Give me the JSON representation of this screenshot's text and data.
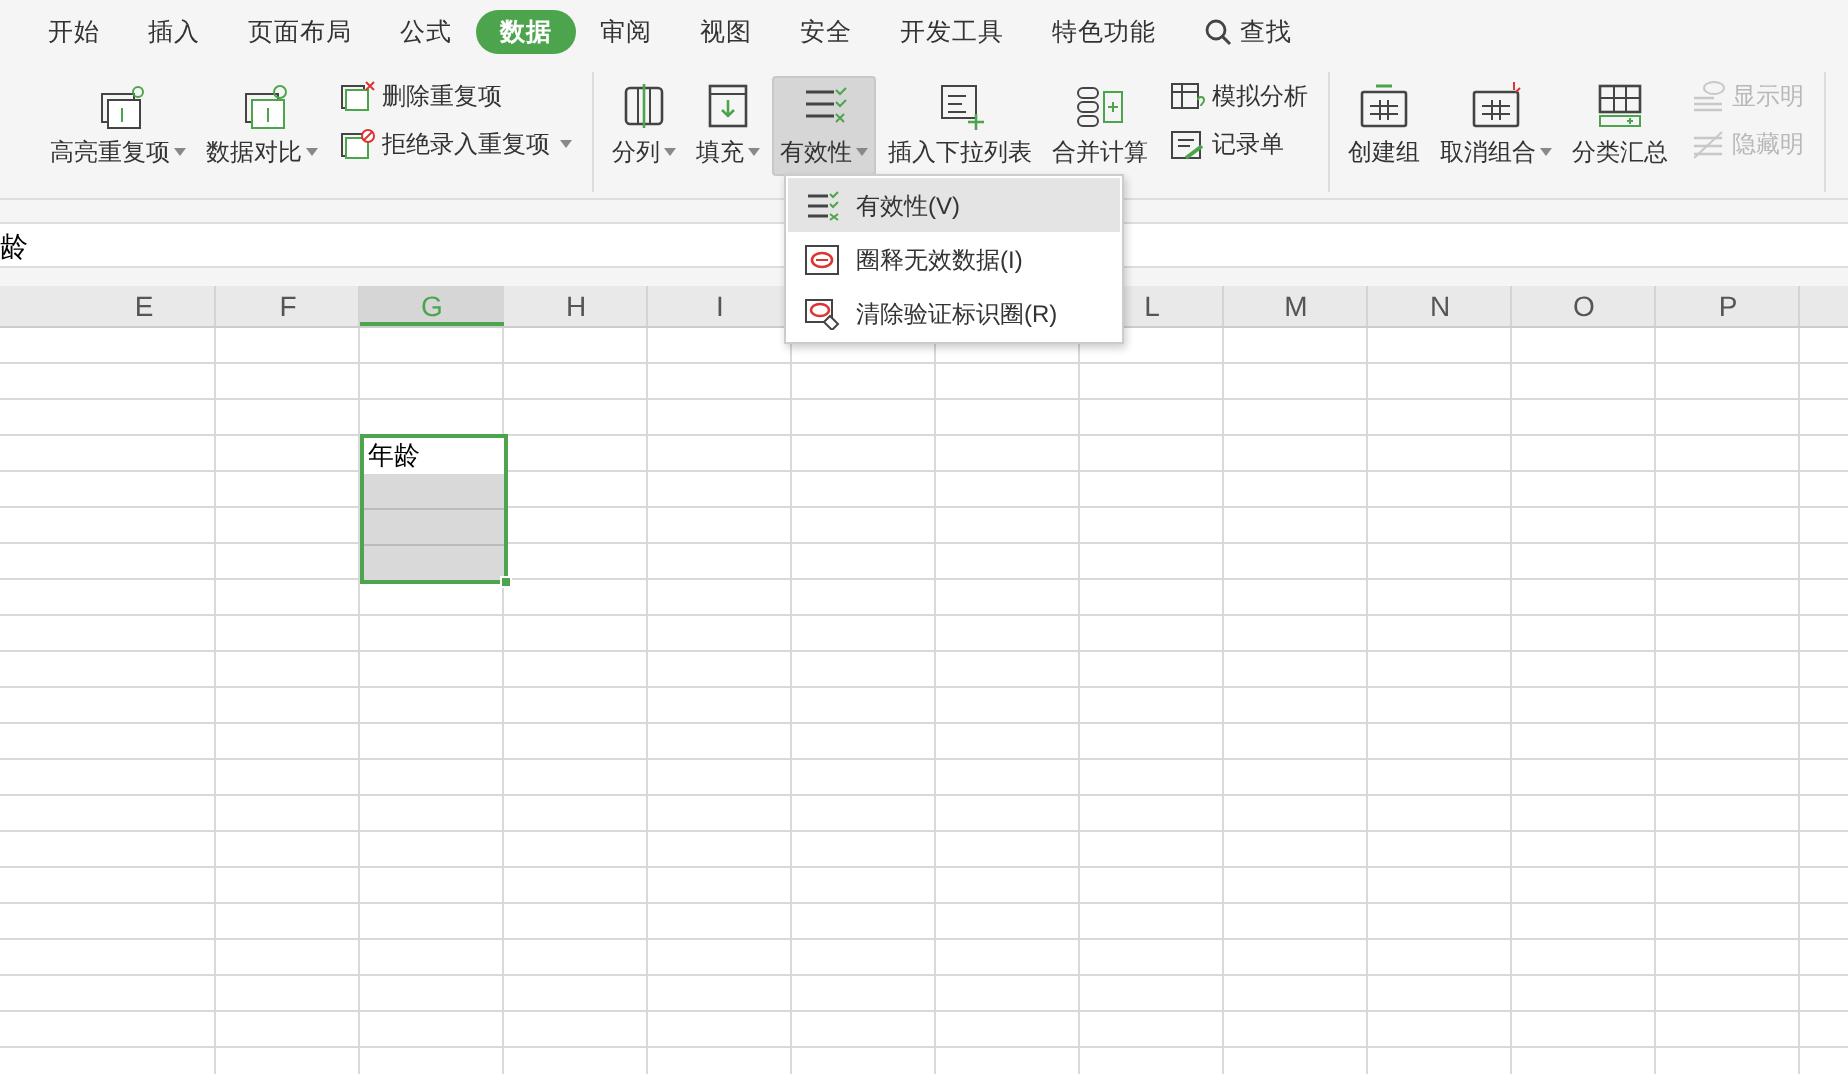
{
  "tabs": [
    {
      "label": "开始",
      "selected": false
    },
    {
      "label": "插入",
      "selected": false
    },
    {
      "label": "页面布局",
      "selected": false
    },
    {
      "label": "公式",
      "selected": false
    },
    {
      "label": "数据",
      "selected": true
    },
    {
      "label": "审阅",
      "selected": false
    },
    {
      "label": "视图",
      "selected": false
    },
    {
      "label": "安全",
      "selected": false
    },
    {
      "label": "开发工具",
      "selected": false
    },
    {
      "label": "特色功能",
      "selected": false
    }
  ],
  "search": {
    "label": "查找"
  },
  "ribbon": {
    "groups": [
      {
        "items": [
          {
            "kind": "big",
            "label": "高亮重复项",
            "dropdown": true,
            "pressed": false
          },
          {
            "kind": "big",
            "label": "数据对比",
            "dropdown": true,
            "pressed": false
          },
          {
            "kind": "stack",
            "items": [
              {
                "label": "删除重复项",
                "dropdown": false,
                "disabled": false
              },
              {
                "label": "拒绝录入重复项",
                "dropdown": true,
                "disabled": false
              }
            ]
          }
        ]
      },
      {
        "items": [
          {
            "kind": "big",
            "label": "分列",
            "dropdown": true,
            "pressed": false
          },
          {
            "kind": "big",
            "label": "填充",
            "dropdown": true,
            "pressed": false
          },
          {
            "kind": "big",
            "label": "有效性",
            "dropdown": true,
            "pressed": true
          },
          {
            "kind": "big",
            "label": "插入下拉列表",
            "dropdown": false,
            "pressed": false
          },
          {
            "kind": "big",
            "label": "合并计算",
            "dropdown": false,
            "pressed": false
          },
          {
            "kind": "stack",
            "items": [
              {
                "label": "模拟分析",
                "dropdown": false,
                "disabled": false
              },
              {
                "label": "记录单",
                "dropdown": false,
                "disabled": false
              }
            ]
          }
        ]
      },
      {
        "items": [
          {
            "kind": "big",
            "label": "创建组",
            "dropdown": false,
            "pressed": false
          },
          {
            "kind": "big",
            "label": "取消组合",
            "dropdown": true,
            "pressed": false
          },
          {
            "kind": "big",
            "label": "分类汇总",
            "dropdown": false,
            "pressed": false
          },
          {
            "kind": "stack",
            "items": [
              {
                "label": "显示明",
                "dropdown": false,
                "disabled": true
              },
              {
                "label": "隐藏明",
                "dropdown": false,
                "disabled": true
              }
            ]
          }
        ]
      }
    ]
  },
  "formula_bar": {
    "value": "龄"
  },
  "sheet": {
    "columns": [
      {
        "label": "E",
        "selected": false
      },
      {
        "label": "F",
        "selected": false
      },
      {
        "label": "G",
        "selected": true
      },
      {
        "label": "H",
        "selected": false
      },
      {
        "label": "I",
        "selected": false
      },
      {},
      {},
      {
        "label": "L",
        "selected": false
      },
      {
        "label": "M",
        "selected": false
      },
      {
        "label": "N",
        "selected": false
      },
      {
        "label": "O",
        "selected": false
      },
      {
        "label": "P",
        "selected": false
      }
    ],
    "active_cell": {
      "value": "年龄"
    }
  },
  "dropdown_menu": {
    "items": [
      {
        "label": "有效性(V)",
        "selected": true
      },
      {
        "label": "圈释无效数据(I)",
        "selected": false
      },
      {
        "label": "清除验证标识圈(R)",
        "selected": false
      }
    ]
  }
}
